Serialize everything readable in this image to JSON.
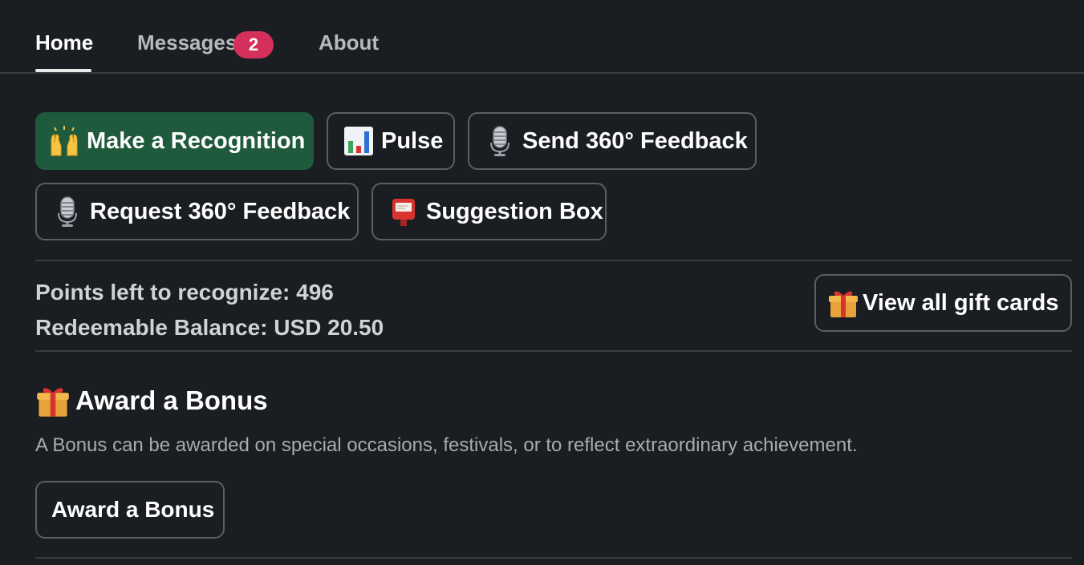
{
  "tabs": [
    {
      "label": "Home",
      "active": true
    },
    {
      "label": "Messages",
      "badge": "2"
    },
    {
      "label": "About"
    }
  ],
  "actions": {
    "make_recognition": {
      "label": "Make a Recognition",
      "icon": "raised-hands-icon"
    },
    "pulse": {
      "label": "Pulse",
      "icon": "bar-chart-icon"
    },
    "send_feedback": {
      "label": "Send 360° Feedback",
      "icon": "microphone-icon"
    },
    "request_feedback": {
      "label": "Request 360° Feedback",
      "icon": "microphone-icon"
    },
    "suggestion_box": {
      "label": "Suggestion Box",
      "icon": "postbox-icon"
    }
  },
  "balance": {
    "points_left": "Points left to recognize: 496",
    "redeemable": "Redeemable Balance: USD 20.50",
    "gift_cards_label": "View all gift cards",
    "gift_cards_icon": "gift-icon"
  },
  "bonus": {
    "title": "Award a Bonus",
    "title_icon": "gift-icon",
    "description": "A Bonus can be awarded on special occasions, festivals, or to reflect extraordinary achievement.",
    "button_label": "Award a Bonus"
  },
  "colors": {
    "background": "#1a1d21",
    "primary_button": "#1f5a3d",
    "badge": "#d5305c",
    "border": "#5c5e62"
  }
}
